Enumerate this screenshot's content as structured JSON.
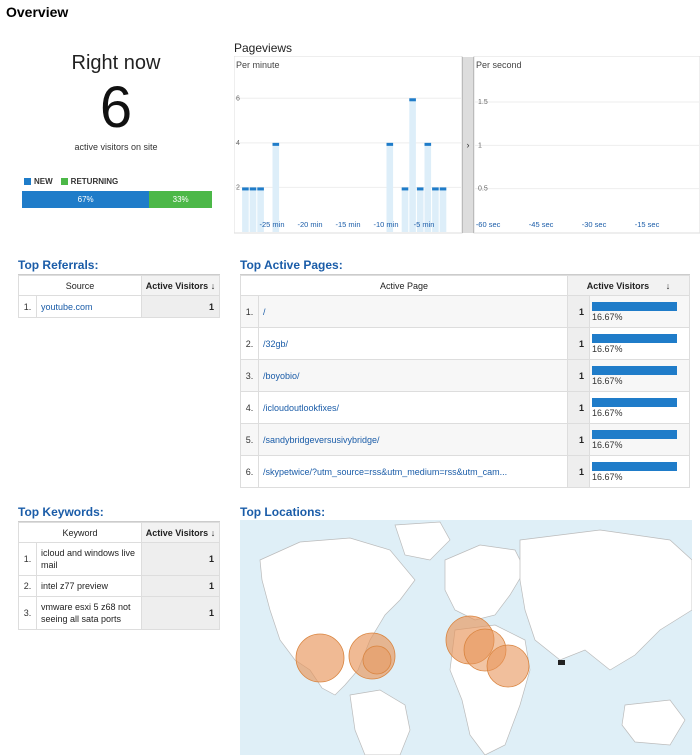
{
  "page_title": "Overview",
  "right_now": {
    "title": "Right now",
    "count": "6",
    "subtitle": "active visitors on site",
    "legend_new": "NEW",
    "legend_returning": "RETURNING",
    "new_percent_label": "67%",
    "returning_percent_label": "33%",
    "new_fraction": 0.67,
    "color_new": "#1f7cc9",
    "color_returning": "#4cb848"
  },
  "pageviews": {
    "title": "Pageviews",
    "per_minute_label": "Per minute",
    "per_second_label": "Per second",
    "arrow_glyph": "›"
  },
  "chart_data": [
    {
      "type": "bar",
      "title": "Per minute",
      "x_tick_labels": [
        "-25 min",
        "-20 min",
        "-15 min",
        "-10 min",
        "-5 min"
      ],
      "y_tick_labels": [
        "2",
        "4",
        "6"
      ],
      "ylim": [
        0,
        7
      ],
      "xlim": [
        -30,
        0
      ],
      "bars": [
        {
          "x": -29,
          "value": 2
        },
        {
          "x": -28,
          "value": 2
        },
        {
          "x": -27,
          "value": 2
        },
        {
          "x": -25,
          "value": 4
        },
        {
          "x": -10,
          "value": 4
        },
        {
          "x": -8,
          "value": 2
        },
        {
          "x": -7,
          "value": 6
        },
        {
          "x": -6,
          "value": 2
        },
        {
          "x": -5,
          "value": 4
        },
        {
          "x": -4,
          "value": 2
        },
        {
          "x": -3,
          "value": 2
        }
      ],
      "color": "#1f7cc9"
    },
    {
      "type": "bar",
      "title": "Per second",
      "x_tick_labels": [
        "-60 sec",
        "-45 sec",
        "-30 sec",
        "-15 sec"
      ],
      "y_tick_labels": [
        "0.5",
        "1",
        "1.5"
      ],
      "ylim": [
        0,
        1.8
      ],
      "bars": []
    }
  ],
  "top_referrals": {
    "title": "Top Referrals:",
    "col_source": "Source",
    "col_visitors": "Active Visitors",
    "sort_icon": "↓",
    "rows": [
      {
        "index": "1.",
        "source": "youtube.com",
        "visitors": "1"
      }
    ]
  },
  "top_active_pages": {
    "title": "Top Active Pages:",
    "col_page": "Active Page",
    "col_visitors": "Active Visitors",
    "sort_icon": "↓",
    "rows": [
      {
        "index": "1.",
        "page": "/",
        "visitors": "1",
        "percent": "16.67%",
        "fraction": 0.1667
      },
      {
        "index": "2.",
        "page": "/32gb/",
        "visitors": "1",
        "percent": "16.67%",
        "fraction": 0.1667
      },
      {
        "index": "3.",
        "page": "/boyobio/",
        "visitors": "1",
        "percent": "16.67%",
        "fraction": 0.1667
      },
      {
        "index": "4.",
        "page": "/icloudoutlookfixes/",
        "visitors": "1",
        "percent": "16.67%",
        "fraction": 0.1667
      },
      {
        "index": "5.",
        "page": "/sandybridgeversusivybridge/",
        "visitors": "1",
        "percent": "16.67%",
        "fraction": 0.1667
      },
      {
        "index": "6.",
        "page": "/skypetwice/?utm_source=rss&utm_medium=rss&utm_cam...",
        "visitors": "1",
        "percent": "16.67%",
        "fraction": 0.1667
      }
    ]
  },
  "top_keywords": {
    "title": "Top Keywords:",
    "col_keyword": "Keyword",
    "col_visitors": "Active Visitors",
    "sort_icon": "↓",
    "rows": [
      {
        "index": "1.",
        "keyword": "icloud and windows live mail",
        "visitors": "1"
      },
      {
        "index": "2.",
        "keyword": "intel z77 preview",
        "visitors": "1"
      },
      {
        "index": "3.",
        "keyword": "vmware esxi 5 z68 not seeing all sata ports",
        "visitors": "1"
      }
    ]
  },
  "top_locations": {
    "title": "Top Locations:",
    "map_ocean_color": "#dfeff7",
    "land_color": "#ffffff",
    "marker_color": "#e8955a"
  }
}
